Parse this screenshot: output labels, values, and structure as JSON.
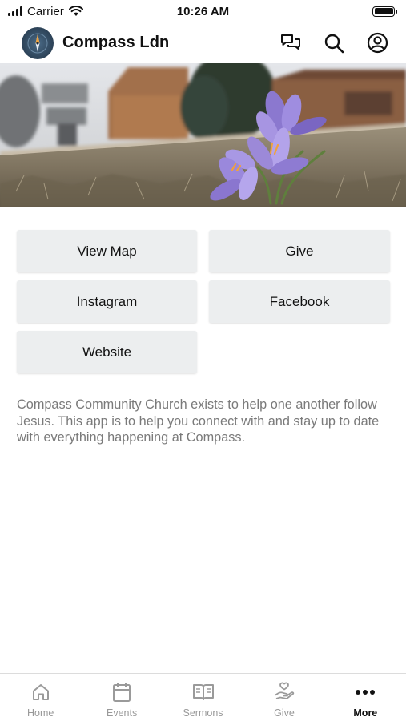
{
  "status_bar": {
    "carrier": "Carrier",
    "time": "10:26 AM"
  },
  "header": {
    "title": "Compass Ldn",
    "icons": [
      "chat-icon",
      "search-icon",
      "account-icon"
    ]
  },
  "hero": {
    "icon": "crocus-flower-photo"
  },
  "buttons": [
    {
      "label": "View Map"
    },
    {
      "label": "Give"
    },
    {
      "label": "Instagram"
    },
    {
      "label": "Facebook"
    },
    {
      "label": "Website"
    }
  ],
  "description": "Compass Community Church exists to help one another follow Jesus. This app is to help you connect with and stay up to date with everything happening at Compass.",
  "tabs": [
    {
      "label": "Home",
      "icon": "home-icon"
    },
    {
      "label": "Events",
      "icon": "calendar-icon"
    },
    {
      "label": "Sermons",
      "icon": "book-icon"
    },
    {
      "label": "Give",
      "icon": "give-hand-icon"
    },
    {
      "label": "More",
      "icon": "more-dots-icon",
      "active": true
    }
  ],
  "colors": {
    "button_bg": "#eceeef",
    "description_text": "#7a7a7a",
    "tab_inactive": "#999999",
    "tab_active": "#111111"
  }
}
